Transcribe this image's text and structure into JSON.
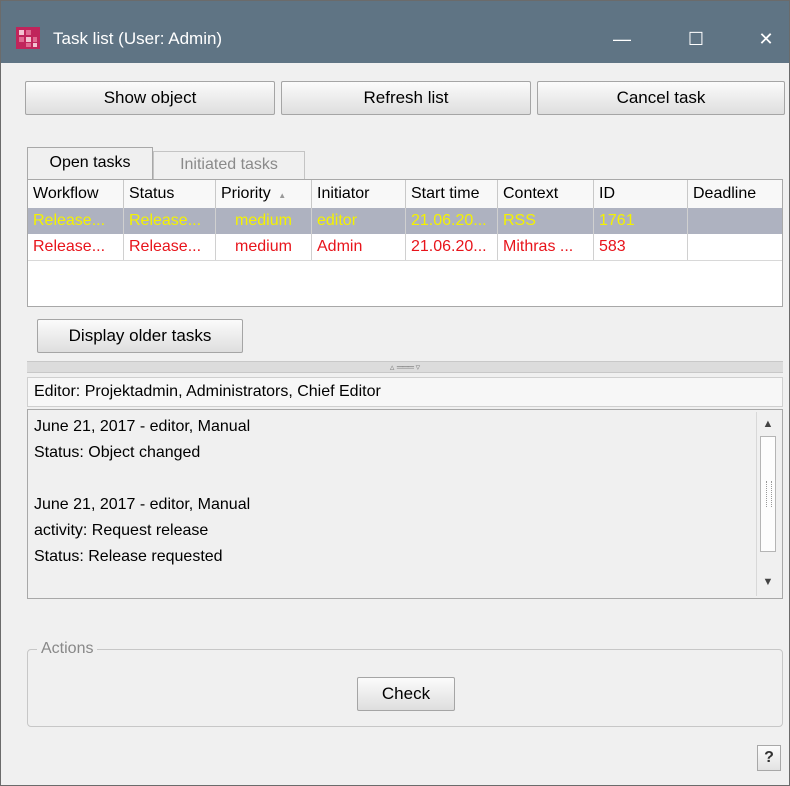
{
  "window": {
    "title": "Task list (User: Admin)",
    "controls": {
      "minimize": "—",
      "maximize": "☐",
      "close": "✕"
    }
  },
  "toolbar": {
    "show_object": "Show object",
    "refresh_list": "Refresh list",
    "cancel_task": "Cancel task"
  },
  "tabs": [
    {
      "label": "Open tasks",
      "active": true
    },
    {
      "label": "Initiated tasks",
      "active": false
    }
  ],
  "table": {
    "columns": [
      "Workflow",
      "Status",
      "Priority",
      "Initiator",
      "Start time",
      "Context",
      "ID",
      "Deadline"
    ],
    "sort_indicator": "▲",
    "rows": [
      {
        "workflow": "Release...",
        "status": "Release...",
        "priority": "medium",
        "initiator": "editor",
        "start_time": "21.06.20...",
        "context": "RSS",
        "id": "1761",
        "deadline": "",
        "selected": true
      },
      {
        "workflow": "Release...",
        "status": "Release...",
        "priority": "medium",
        "initiator": "Admin",
        "start_time": "21.06.20...",
        "context": "Mithras ...",
        "id": "583",
        "deadline": "",
        "selected": false
      }
    ]
  },
  "older_tasks_button": "Display older tasks",
  "editor_line": "Editor: Projektadmin, Administrators, Chief Editor",
  "history": [
    "June 21, 2017 - editor, Manual",
    "Status: Object changed",
    "",
    "June 21, 2017 - editor, Manual",
    "activity: Request release",
    "Status: Release requested"
  ],
  "actions": {
    "label": "Actions",
    "check_button": "Check"
  },
  "help_button": "?",
  "colors": {
    "titlebar": "#5f7484",
    "selected_row_bg": "#aeb2c0",
    "selected_row_text": "#f4f200",
    "row_text_red": "#e8141b"
  }
}
